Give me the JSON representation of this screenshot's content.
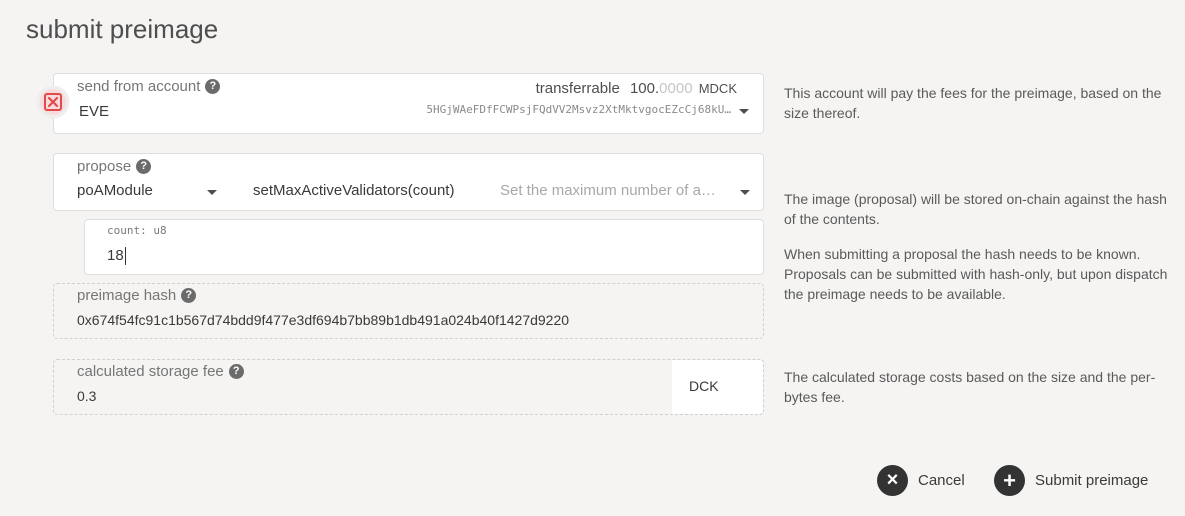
{
  "title": "submit preimage",
  "account": {
    "label": "send from account",
    "name": "EVE",
    "transferrable_label": "transferrable",
    "balance_int": "100.",
    "balance_dec": "0000",
    "unit": "MDCK",
    "address": "5HGjWAeFDfFCWPsjFQdVV2Msvz2XtMktvgocEZcCj68kU…",
    "description": "This account will pay the fees for the preimage, based on the size thereof."
  },
  "propose": {
    "label": "propose",
    "module": "poAModule",
    "method": "setMaxActiveValidators(count)",
    "method_description": "Set the maximum number of a…",
    "description": "The image (proposal) will be stored on-chain against the hash of the contents."
  },
  "param": {
    "label": "count: u8",
    "value": "18",
    "description": "When submitting a proposal the hash needs to be known. Proposals can be submitted with hash-only, but upon dispatch the preimage needs to be available."
  },
  "hash": {
    "label": "preimage hash",
    "value": "0x674f54fc91c1b567d74bdd9f477e3df694b7bb89b1db491a024b40f1427d9220"
  },
  "fee": {
    "label": "calculated storage fee",
    "value": "0.3",
    "unit": "DCK",
    "description": "The calculated storage costs based on the size and the per-bytes fee."
  },
  "buttons": {
    "cancel": "Cancel",
    "submit": "Submit preimage"
  },
  "icons": {
    "help": "?",
    "cancel": "×",
    "submit": "+"
  }
}
